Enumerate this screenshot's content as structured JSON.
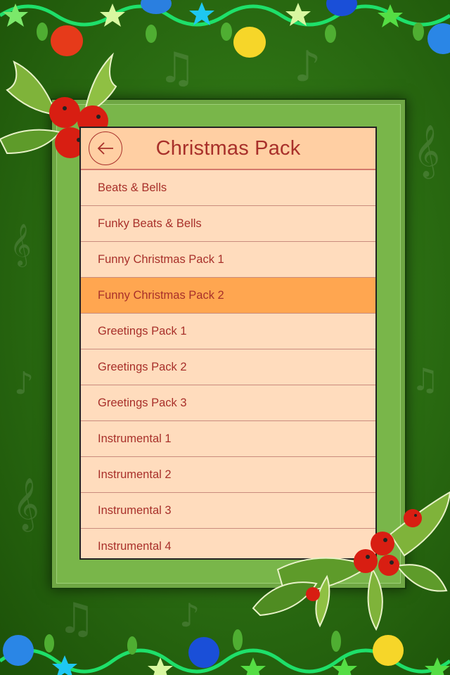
{
  "header": {
    "title": "Christmas Pack",
    "back_icon": "arrow-left-icon"
  },
  "list": {
    "selected_index": 3,
    "items": [
      {
        "label": "Beats & Bells"
      },
      {
        "label": "Funky Beats & Bells"
      },
      {
        "label": "Funny Christmas Pack 1"
      },
      {
        "label": "Funny Christmas Pack 2"
      },
      {
        "label": "Greetings Pack 1"
      },
      {
        "label": "Greetings Pack 2"
      },
      {
        "label": "Greetings Pack 3"
      },
      {
        "label": "Instrumental 1"
      },
      {
        "label": "Instrumental 2"
      },
      {
        "label": "Instrumental 3"
      },
      {
        "label": "Instrumental 4"
      }
    ]
  },
  "colors": {
    "accent_text": "#a8302a",
    "header_bg": "#ffcfa3",
    "row_bg": "#ffdcbd",
    "selected_row_bg": "#ffa650",
    "frame_green": "#79b64a",
    "background_green": "#2c6f13"
  },
  "decorations": {
    "top_garland_icon": "christmas-lights-garland-icon",
    "bottom_garland_icon": "christmas-lights-garland-icon",
    "holly_icon": "holly-berries-icon",
    "music_note_icon": "music-note-icon",
    "treble_clef_icon": "treble-clef-icon"
  }
}
